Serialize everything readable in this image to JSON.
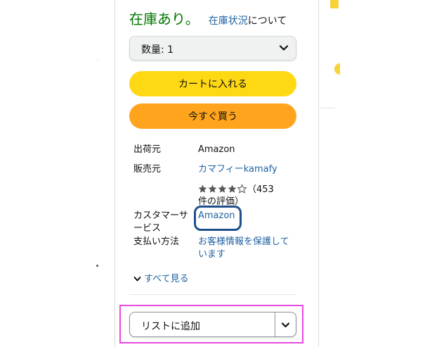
{
  "availability": {
    "status": "在庫あり。",
    "link": "在庫状況",
    "suffix": "について"
  },
  "quantity": {
    "label": "数量: 1"
  },
  "buttons": {
    "add_to_cart": "カートに入れる",
    "buy_now": "今すぐ買う"
  },
  "details": {
    "ships_from_label": "出荷元",
    "ships_from_value": "Amazon",
    "sold_by_label": "販売元",
    "sold_by_value": "カマフィーkamafy",
    "rating": {
      "stars": 4.5,
      "count_text": "（453件の評価）"
    },
    "customer_service_label": "カスタマーサービス",
    "customer_service_value": "Amazon",
    "payment_label": "支払い方法",
    "payment_value": "お客様情報を保護しています"
  },
  "see_all": "すべて見る",
  "add_to_list": "リストに追加",
  "colors": {
    "in_stock": "#007600",
    "link": "#2162a1",
    "cart_button": "#ffd814",
    "buy_button": "#ffa41c",
    "stars": "#ffa41c",
    "highlight_blue": "#1f4f8a",
    "highlight_pink": "#e84ae0"
  },
  "icons": [
    "chevron-down-icon",
    "star-icon",
    "half-star-icon"
  ]
}
